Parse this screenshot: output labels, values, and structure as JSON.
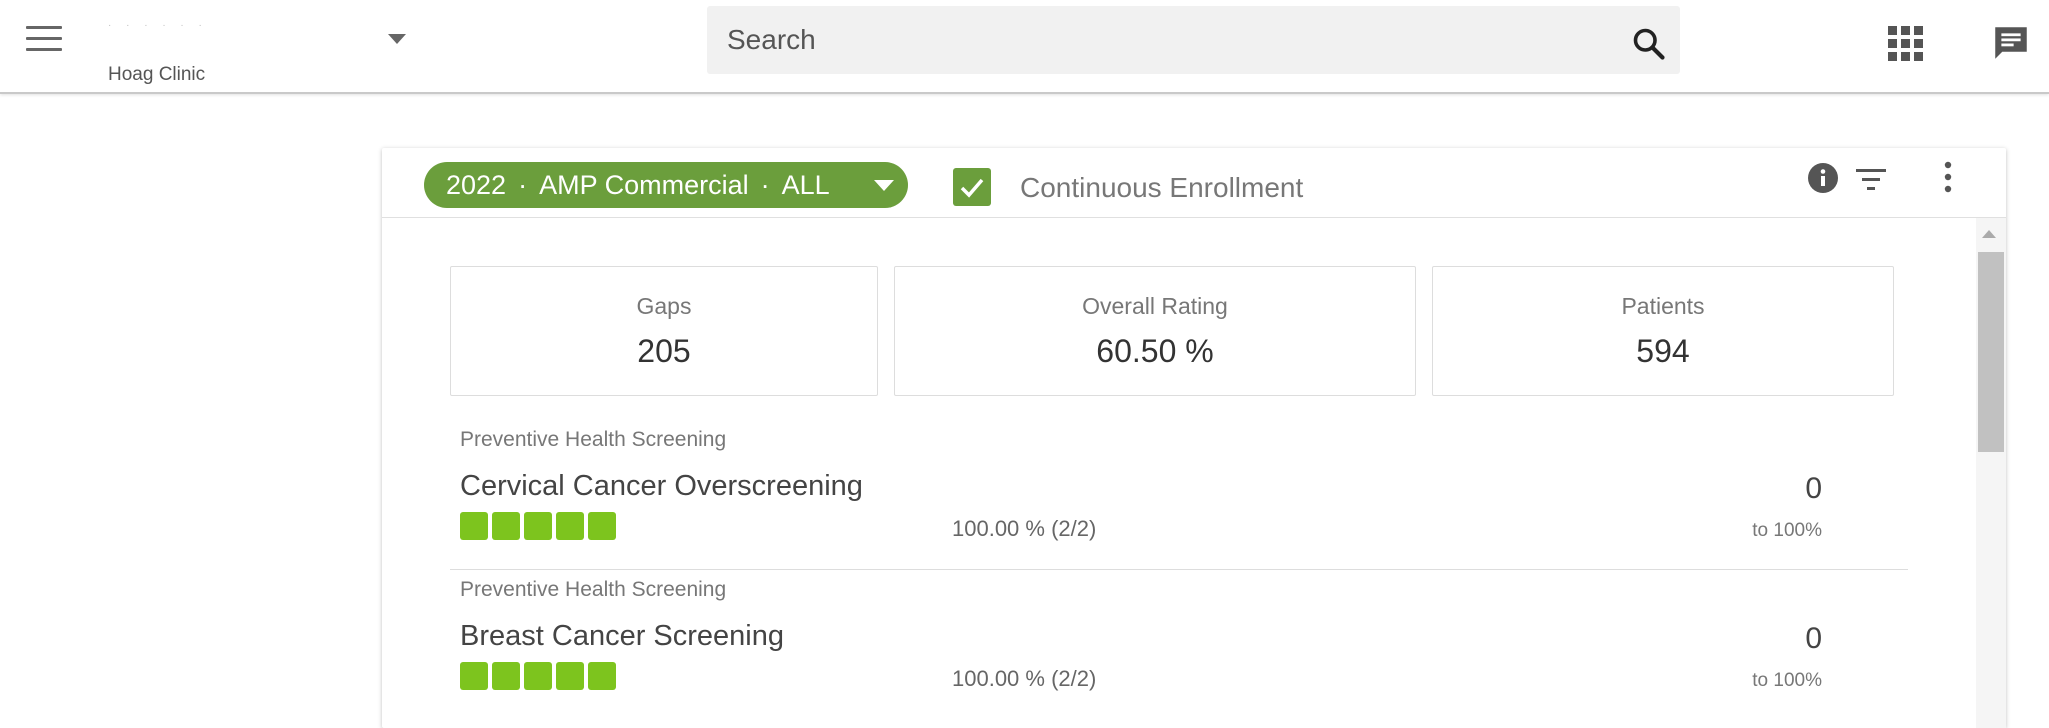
{
  "header": {
    "org_name": "· · · ·   ·         ·",
    "org_sub": "Hoag Clinic",
    "search_placeholder": "Search"
  },
  "filter": {
    "year": "2022",
    "plan": "AMP Commercial",
    "scope": "ALL",
    "separator": "·",
    "continuous_enrollment_label": "Continuous Enrollment",
    "continuous_enrollment_checked": true
  },
  "stats": [
    {
      "label": "Gaps",
      "value": "205"
    },
    {
      "label": "Overall Rating",
      "value": "60.50 %"
    },
    {
      "label": "Patients",
      "value": "594"
    }
  ],
  "measures": [
    {
      "category": "Preventive Health Screening",
      "title": "Cervical Cancer Overscreening",
      "stars": 5,
      "pct": "100.00 %  (2/2)",
      "gaps": "0",
      "to_label": "to 100%"
    },
    {
      "category": "Preventive Health Screening",
      "title": "Breast Cancer Screening",
      "stars": 5,
      "pct": "100.00 %  (2/2)",
      "gaps": "0",
      "to_label": "to 100%"
    }
  ],
  "colors": {
    "accent_green": "#6b9e3c",
    "star_green": "#7dc41e"
  }
}
